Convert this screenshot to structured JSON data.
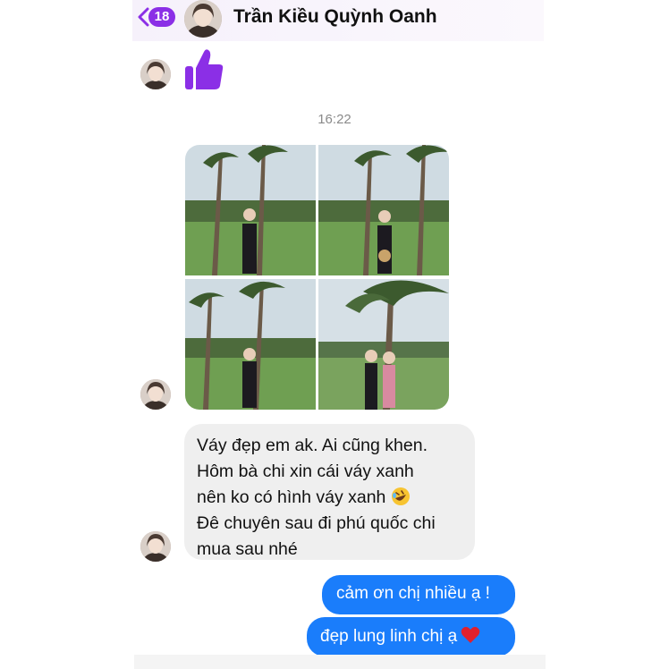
{
  "header": {
    "back_label": "<",
    "unread_count": "18",
    "contact_name": "Trần Kiều Quỳnh Oanh"
  },
  "timestamp": "16:22",
  "messages": {
    "incoming_lines": [
      "Váy đẹp em ak. Ai cũng khen.",
      "Hôm bà chi xin cái váy xanh",
      "nên ko có hình váy xanh",
      "Đê chuyên sau đi phú quốc chi",
      "mua sau nhé"
    ],
    "outgoing": [
      "cảm ơn chị nhiều ạ !",
      "đẹp lung linh chị ạ"
    ]
  },
  "icons": {
    "thumbs_up": "thumbs-up-icon",
    "laugh_emoji": "rolling-laughing-emoji-icon",
    "heart": "red-heart-icon"
  },
  "colors": {
    "accent_purple": "#8b2fe6",
    "outgoing_blue": "#1a7dfb",
    "incoming_gray": "#efefef",
    "heart_red": "#e0202d"
  }
}
